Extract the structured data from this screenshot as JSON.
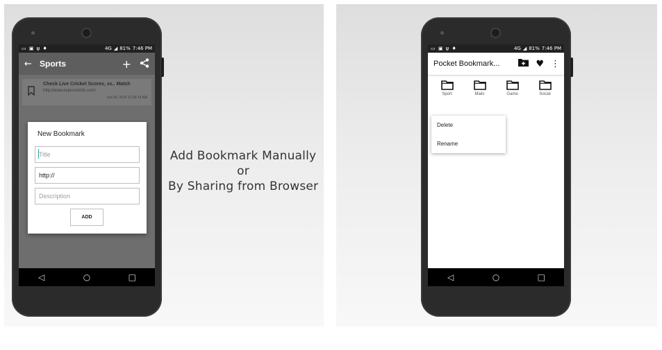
{
  "tagline": {
    "line1": "Add Bookmark Manually",
    "line2": "or",
    "line3": "By Sharing from Browser"
  },
  "status_bar": {
    "network": "4G",
    "battery": "81%",
    "time": "7:46 PM"
  },
  "left_screen": {
    "appbar": {
      "back_icon": "arrow-left-icon",
      "title": "Sports",
      "add_icon": "plus-icon",
      "share_icon": "share-icon"
    },
    "bookmark": {
      "icon": "bookmark-icon",
      "title": "Check Live Cricket Scores, vs.. Match",
      "url": "http://www.espncricinfo.com/",
      "date": "Jun 30, 2015 12:29:14 AM"
    },
    "dialog": {
      "title": "New Bookmark",
      "title_placeholder": "Title",
      "url_value": "http://",
      "description_placeholder": "Description",
      "add_label": "ADD"
    }
  },
  "right_screen": {
    "appbar": {
      "title": "Pocket Bookmark...",
      "new_folder_icon": "folder-plus-icon",
      "favorite_icon": "heart-icon",
      "more_icon": "more-vert-icon"
    },
    "folders": [
      {
        "label": "Sport"
      },
      {
        "label": "Mails"
      },
      {
        "label": "Game"
      },
      {
        "label": "Social"
      }
    ],
    "context_menu": [
      {
        "label": "Delete"
      },
      {
        "label": "Rename"
      }
    ]
  },
  "nav_bar": {
    "back_icon": "nav-back-icon",
    "home_icon": "nav-home-icon",
    "recents_icon": "nav-recents-icon"
  },
  "colors": {
    "dim_overlay": "#6e6e6e",
    "appbar_dark": "#5e5e5e",
    "accent_cursor": "#26a69a",
    "phone_body": "#2b2b2b"
  }
}
